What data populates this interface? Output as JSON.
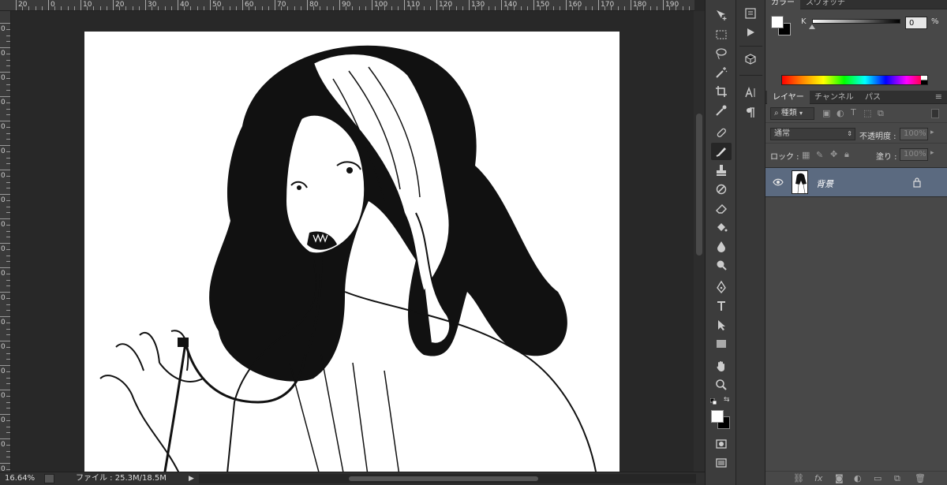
{
  "rulers": {
    "top_labels": [
      "20",
      "0",
      "10",
      "20",
      "30",
      "40",
      "50",
      "60",
      "70",
      "80",
      "90",
      "100",
      "110",
      "120",
      "130",
      "140",
      "150",
      "160",
      "170",
      "180",
      "190",
      "200"
    ],
    "left_labels": [
      "0",
      "0",
      "0",
      "0",
      "0",
      "0",
      "0",
      "0",
      "0",
      "0",
      "0",
      "0",
      "0",
      "0",
      "0",
      "0",
      "0",
      "0",
      "0"
    ]
  },
  "status": {
    "zoom": "16.64%",
    "file_info": "ファイル : 25.3M/18.5M"
  },
  "color_panel": {
    "tabs": [
      "カラー",
      "スウォッチ"
    ],
    "k_label": "K",
    "k_value": "0",
    "k_unit": "%"
  },
  "layers_panel": {
    "tabs": [
      "レイヤー",
      "チャンネル",
      "パス"
    ],
    "filter_kind": "種類",
    "blend_mode": "通常",
    "opacity_label": "不透明度 :",
    "opacity_value": "100%",
    "lock_label": "ロック :",
    "fill_label": "塗り :",
    "fill_value": "100%",
    "layer_name": "背景"
  },
  "colors": {
    "active_layer": "#5b6a80",
    "panel_bg": "#484848",
    "canvas_bg": "#282828"
  }
}
